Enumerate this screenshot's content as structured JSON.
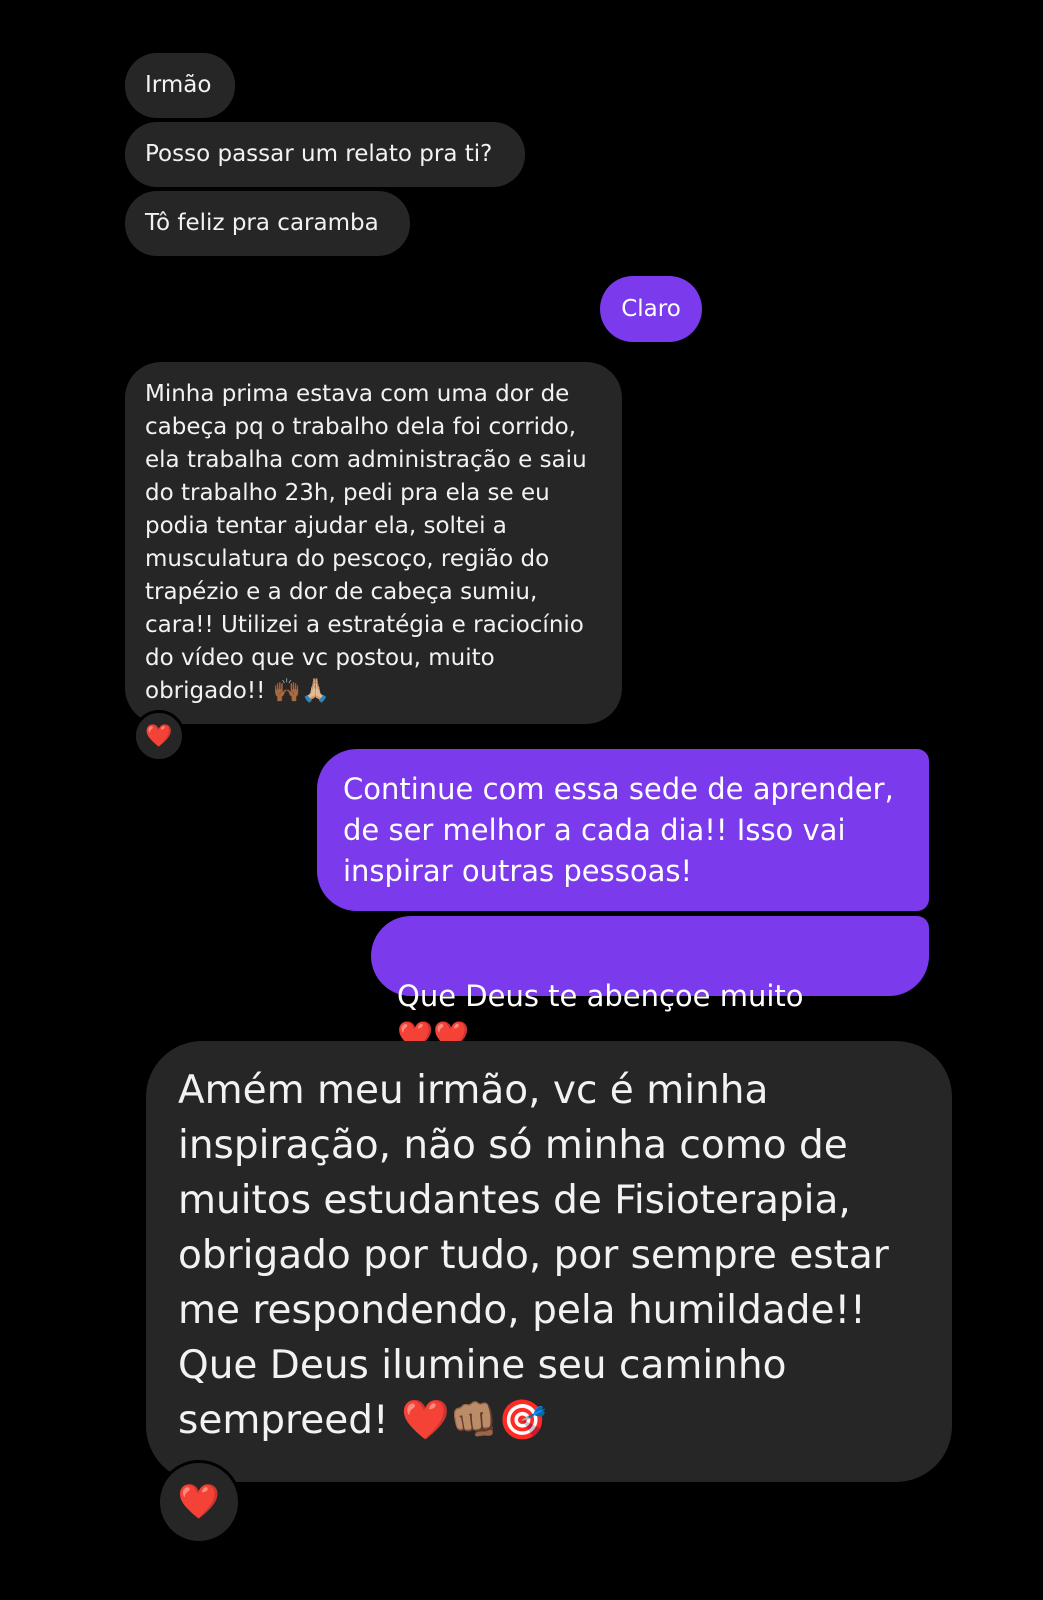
{
  "conversation": {
    "messages": [
      {
        "direction": "incoming",
        "text": "Irmão"
      },
      {
        "direction": "incoming",
        "text": "Posso passar um relato pra ti?"
      },
      {
        "direction": "incoming",
        "text": "Tô feliz pra caramba"
      },
      {
        "direction": "outgoing",
        "text": "Claro"
      },
      {
        "direction": "incoming",
        "text": "Minha prima estava com uma dor de\ncabeça pq o trabalho dela foi corrido,\nela trabalha com administração e saiu\ndo trabalho 23h, pedi pra ela se eu\npodia tentar ajudar ela, soltei a\nmusculatura do pescoço, região do\ntrapézio e a dor de cabeça sumiu,\ncara!! Utilizei a estratégia e raciocínio\ndo vídeo que vc postou, muito\nobrigado!! 🙌🏾🙏🏼",
        "reaction": "❤️"
      },
      {
        "direction": "outgoing",
        "text": "Continue com essa sede de aprender,\nde ser melhor a cada dia!! Isso vai\ninspirar outras pessoas!"
      },
      {
        "direction": "outgoing",
        "text": "Que Deus te abençoe muito",
        "emoji": "❤️❤️"
      },
      {
        "direction": "incoming",
        "text": "Amém meu irmão, vc é minha\ninspiração, não só minha como de\nmuitos estudantes de Fisioterapia,\nobrigado por tudo, por sempre estar\nme respondendo, pela humildade!!\nQue Deus ilumine seu caminho\nsempreed! ❤️👊🏽🎯",
        "reaction": "❤️"
      }
    ]
  },
  "colors": {
    "background": "#000000",
    "incoming_bubble": "#262626",
    "outgoing_bubble": "#7c3aed",
    "text": "#ffffff",
    "heart": "#ff2438"
  }
}
